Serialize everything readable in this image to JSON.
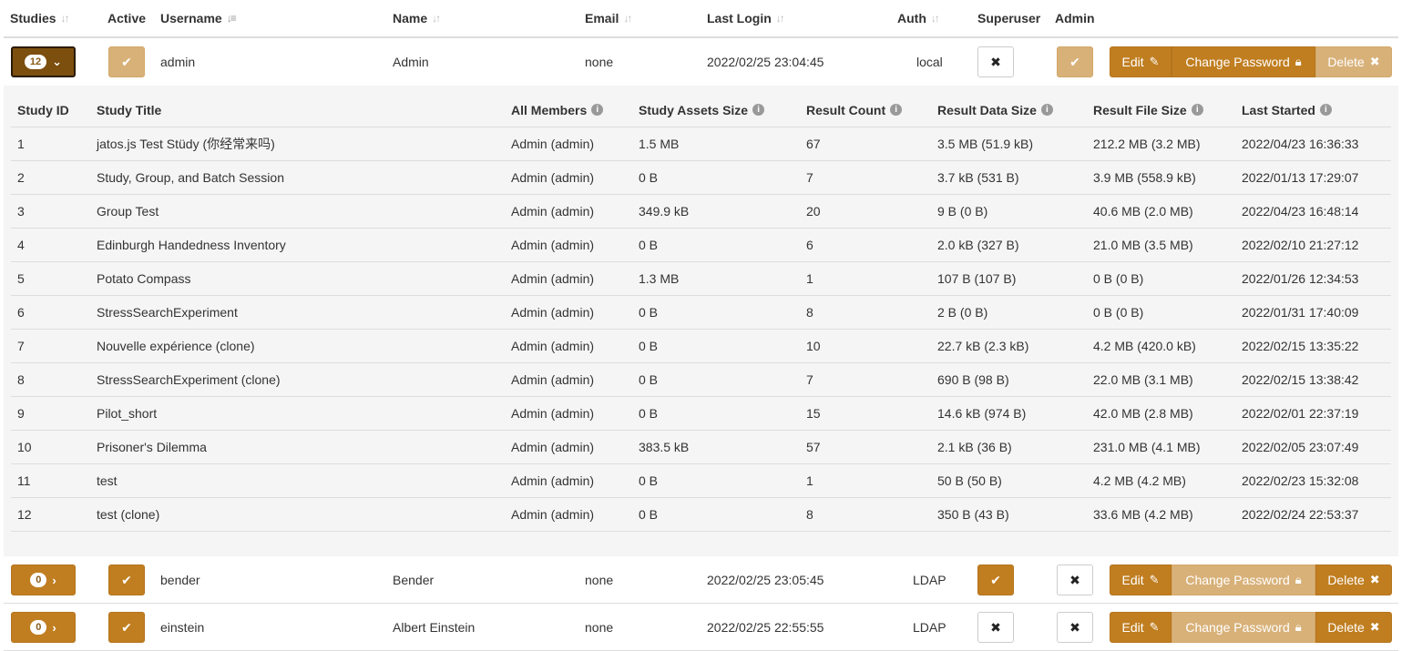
{
  "header": {
    "studies": "Studies",
    "active": "Active",
    "username": "Username",
    "name": "Name",
    "email": "Email",
    "last_login": "Last Login",
    "auth": "Auth",
    "superuser": "Superuser",
    "admin": "Admin"
  },
  "buttons": {
    "edit": "Edit",
    "change_password": "Change Password",
    "delete": "Delete"
  },
  "study_table": {
    "headers": [
      "Study ID",
      "Study Title",
      "All Members",
      "Study Assets Size",
      "Result Count",
      "Result Data Size",
      "Result File Size",
      "Last Started"
    ],
    "rows": [
      [
        "1",
        "jatos.js Test Stüdy (你经常来吗)",
        "Admin (admin)",
        "1.5 MB",
        "67",
        "3.5 MB (51.9 kB)",
        "212.2 MB (3.2 MB)",
        "2022/04/23 16:36:33"
      ],
      [
        "2",
        "Study, Group, and Batch Session",
        "Admin (admin)",
        "0 B",
        "7",
        "3.7 kB (531 B)",
        "3.9 MB (558.9 kB)",
        "2022/01/13 17:29:07"
      ],
      [
        "3",
        "Group Test",
        "Admin (admin)",
        "349.9 kB",
        "20",
        "9 B (0 B)",
        "40.6 MB (2.0 MB)",
        "2022/04/23 16:48:14"
      ],
      [
        "4",
        "Edinburgh Handedness Inventory",
        "Admin (admin)",
        "0 B",
        "6",
        "2.0 kB (327 B)",
        "21.0 MB (3.5 MB)",
        "2022/02/10 21:27:12"
      ],
      [
        "5",
        "Potato Compass",
        "Admin (admin)",
        "1.3 MB",
        "1",
        "107 B (107 B)",
        "0 B (0 B)",
        "2022/01/26 12:34:53"
      ],
      [
        "6",
        "StressSearchExperiment",
        "Admin (admin)",
        "0 B",
        "8",
        "2 B (0 B)",
        "0 B (0 B)",
        "2022/01/31 17:40:09"
      ],
      [
        "7",
        "Nouvelle expérience (clone)",
        "Admin (admin)",
        "0 B",
        "10",
        "22.7 kB (2.3 kB)",
        "4.2 MB (420.0 kB)",
        "2022/02/15 13:35:22"
      ],
      [
        "8",
        "StressSearchExperiment (clone)",
        "Admin (admin)",
        "0 B",
        "7",
        "690 B (98 B)",
        "22.0 MB (3.1 MB)",
        "2022/02/15 13:38:42"
      ],
      [
        "9",
        "Pilot_short",
        "Admin (admin)",
        "0 B",
        "15",
        "14.6 kB (974 B)",
        "42.0 MB (2.8 MB)",
        "2022/02/01 22:37:19"
      ],
      [
        "10",
        "Prisoner's Dilemma",
        "Admin (admin)",
        "383.5 kB",
        "57",
        "2.1 kB (36 B)",
        "231.0 MB (4.1 MB)",
        "2022/02/05 23:07:49"
      ],
      [
        "11",
        "test",
        "Admin (admin)",
        "0 B",
        "1",
        "50 B (50 B)",
        "4.2 MB (4.2 MB)",
        "2022/02/23 15:32:08"
      ],
      [
        "12",
        "test (clone)",
        "Admin (admin)",
        "0 B",
        "8",
        "350 B (43 B)",
        "33.6 MB (4.2 MB)",
        "2022/02/24 22:53:37"
      ]
    ]
  },
  "users": [
    {
      "studies_count": "12",
      "expanded": true,
      "active": true,
      "username": "admin",
      "name": "Admin",
      "email": "none",
      "last_login": "2022/02/25 23:04:45",
      "auth": "local",
      "superuser": false,
      "admin": true
    },
    {
      "studies_count": "0",
      "expanded": false,
      "active": true,
      "username": "bender",
      "name": "Bender",
      "email": "none",
      "last_login": "2022/02/25 23:05:45",
      "auth": "LDAP",
      "superuser": true,
      "admin": false
    },
    {
      "studies_count": "0",
      "expanded": false,
      "active": true,
      "username": "einstein",
      "name": "Albert Einstein",
      "email": "none",
      "last_login": "2022/02/25 22:55:55",
      "auth": "LDAP",
      "superuser": false,
      "admin": false
    }
  ],
  "colors": {
    "accent": "#c07e20",
    "accent_light": "#d8b179",
    "accent_dark": "#7c4f0f"
  },
  "icons": {
    "sort": "sort-icon",
    "check": "check-icon",
    "cross": "cross-icon",
    "edit": "edit-icon",
    "lock": "lock-icon",
    "delete": "delete-icon",
    "info": "info-icon",
    "chevron_down": "chevron-down-icon",
    "chevron_right": "chevron-right-icon"
  }
}
